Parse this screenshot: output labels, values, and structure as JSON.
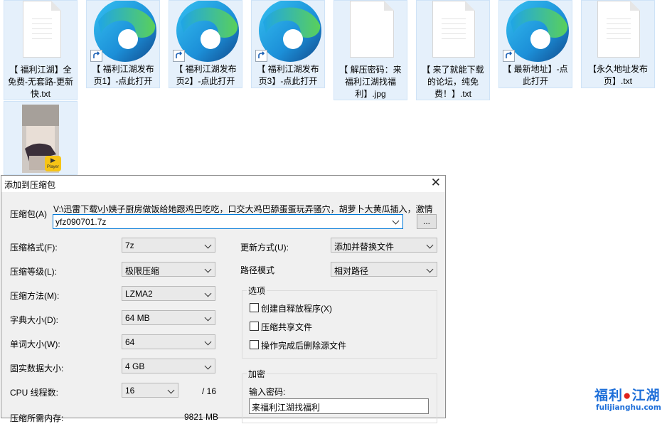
{
  "desktop": {
    "icons": [
      {
        "label": "【 福利江湖】全免费-无套路-更新快.txt",
        "type": "txt"
      },
      {
        "label": "【 福利江湖发布页1】-点此打开",
        "type": "edge-shortcut"
      },
      {
        "label": "【 福利江湖发布页2】-点此打开",
        "type": "edge-shortcut"
      },
      {
        "label": "【 福利江湖发布页3】-点此打开",
        "type": "edge-shortcut"
      },
      {
        "label": "【 解压密码：来福利江湖找福利】.jpg",
        "type": "jpg"
      },
      {
        "label": "【 来了就能下载的论坛，纯免费！】.txt",
        "type": "txt"
      },
      {
        "label": "【 最新地址】-点此打开",
        "type": "edge-shortcut"
      },
      {
        "label": "【永久地址发布页】.txt",
        "type": "txt"
      },
      {
        "label": "",
        "type": "video",
        "badge": "Player"
      }
    ]
  },
  "dialog": {
    "title": "添加到压缩包",
    "archive_label": "压缩包(A)",
    "archive_path": "V:\\迅雷下载\\小姨子厨房做饭给她跟鸡巴吃吃，口交大鸡巴舔蛋蛋玩弄骚穴，胡萝卜大黄瓜插入，激情",
    "archive_name": "yfz090701.7z",
    "browse_label": "...",
    "fields": [
      {
        "label": "压缩格式(F):",
        "value": "7z"
      },
      {
        "label": "压缩等级(L):",
        "value": "极限压缩"
      },
      {
        "label": "压缩方法(M):",
        "value": "LZMA2"
      },
      {
        "label": "字典大小(D):",
        "value": "64 MB"
      },
      {
        "label": "单词大小(W):",
        "value": "64"
      },
      {
        "label": "固实数据大小:",
        "value": "4 GB"
      },
      {
        "label": "CPU 线程数:",
        "value": "16",
        "suffix": "/ 16"
      }
    ],
    "memory_label": "压缩所需内存:",
    "memory_value": "9821 MB",
    "update_mode_label": "更新方式(U):",
    "update_mode_value": "添加并替换文件",
    "path_mode_label": "路径模式",
    "path_mode_value": "相对路径",
    "options": {
      "caption": "选项",
      "items": [
        "创建自释放程序(X)",
        "压缩共享文件",
        "操作完成后删除源文件"
      ]
    },
    "encryption": {
      "caption": "加密",
      "password_label": "输入密码:",
      "password_value": "来福利江湖找福利"
    }
  },
  "watermark": {
    "text_a": "福利",
    "text_b": "江湖",
    "url": "fulijianghu.com"
  }
}
